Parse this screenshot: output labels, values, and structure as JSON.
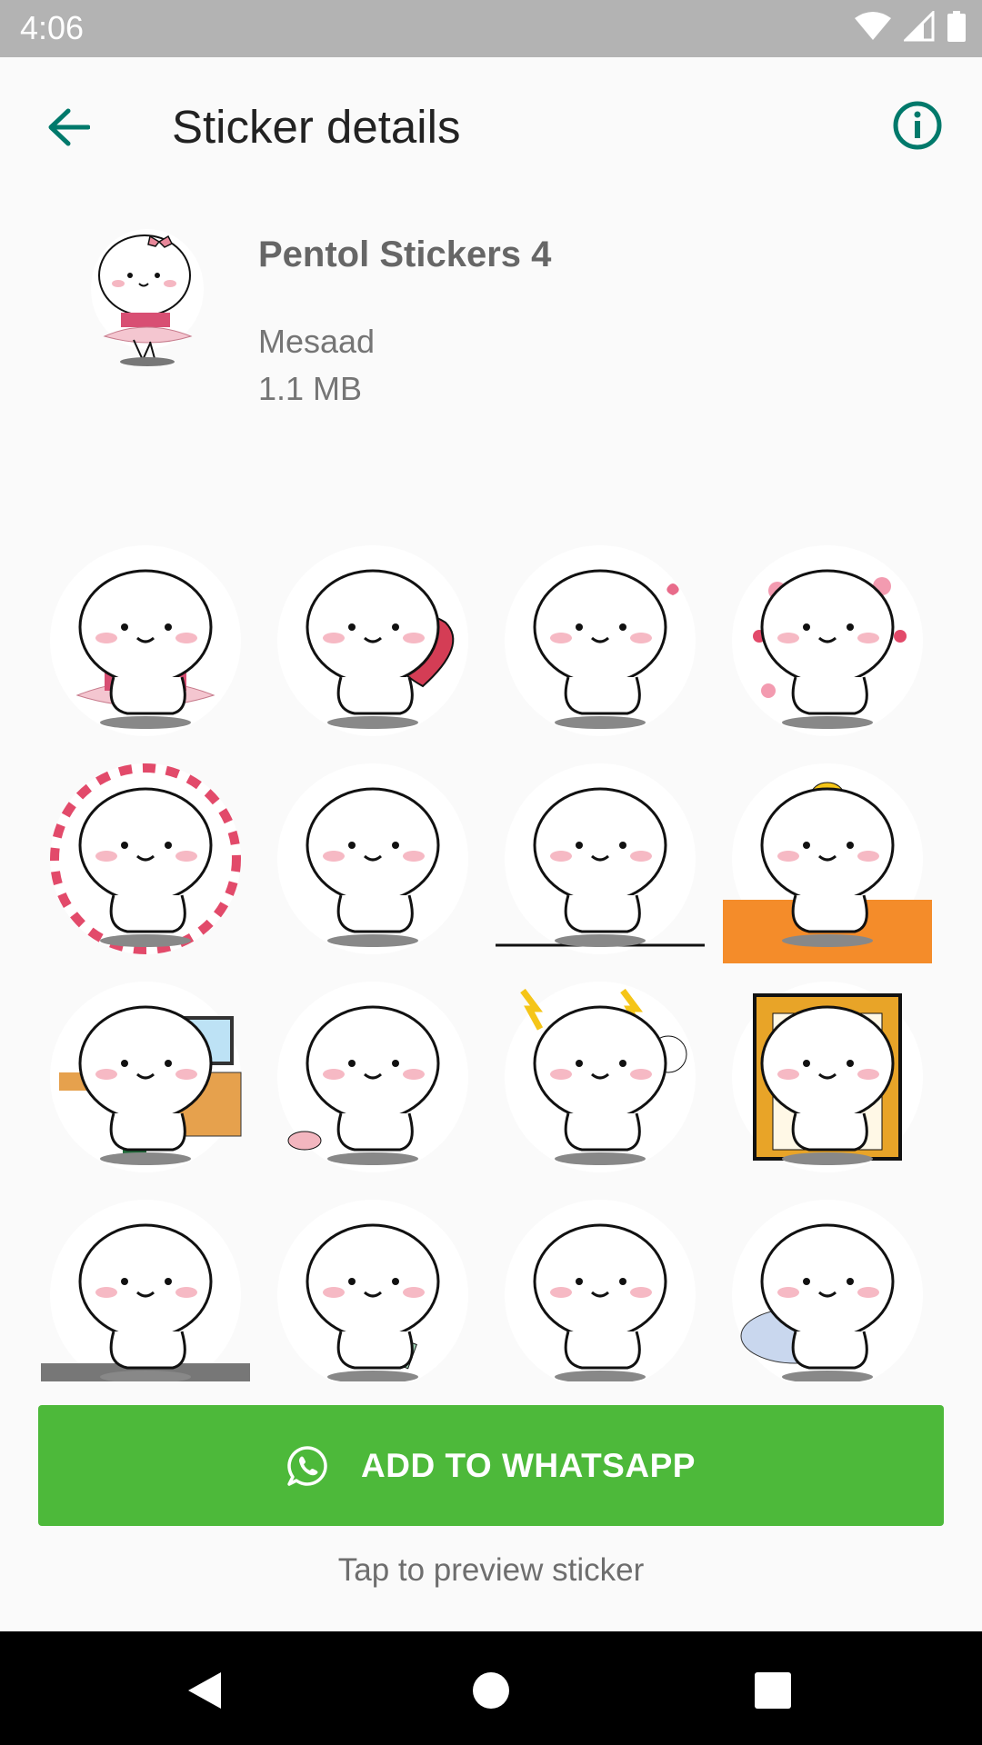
{
  "status_bar": {
    "time": "4:06",
    "icons": [
      "wifi-icon",
      "cellular-icon",
      "battery-icon"
    ]
  },
  "app_bar": {
    "title": "Sticker details",
    "back_icon": "arrow-left-icon",
    "info_icon": "info-icon"
  },
  "pack": {
    "name": "Pentol Stickers 4",
    "publisher": "Mesaad",
    "size": "1.1 MB"
  },
  "stickers": [
    "ballerina",
    "heart-hug",
    "phone-sit",
    "flowers-phone",
    "heart-ring",
    "thinking",
    "peek-table",
    "duck-hat",
    "computer-drink",
    "mouse-pull",
    "lightning-sing",
    "cabinet-hide",
    "pigtails-table",
    "lying-phone",
    "surprised",
    "chicken-bed"
  ],
  "actions": {
    "add_label": "ADD TO WHATSAPP",
    "add_icon": "whatsapp-icon",
    "hint": "Tap to preview sticker"
  },
  "nav": {
    "back": "nav-back-icon",
    "home": "nav-home-icon",
    "recents": "nav-recents-icon"
  },
  "colors": {
    "accent": "#00796b",
    "add_button": "#4db93a",
    "status_bar": "#b3b3b3",
    "nav_bar": "#000000"
  }
}
